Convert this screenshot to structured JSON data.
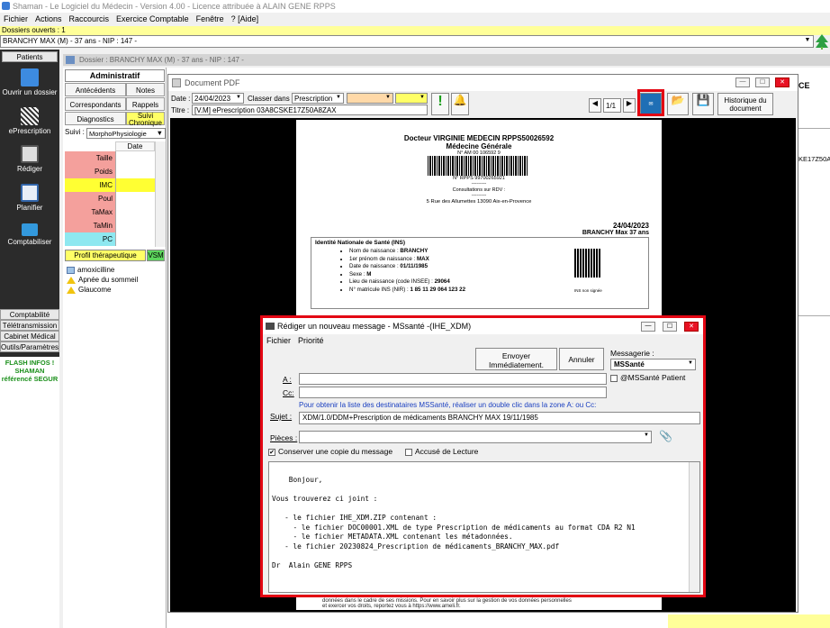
{
  "app": {
    "title": "Shaman - Le Logiciel du Médecin - Version 4.00 - Licence attribuée à ALAIN GENE RPPS",
    "menu": [
      "Fichier",
      "Actions",
      "Raccourcis",
      "Exercice Comptable",
      "Fenêtre",
      "? [Aide]"
    ],
    "dossiers_ouverts": "Dossiers ouverts : 1",
    "patient_combo": "BRANCHY MAX (M) - 37 ans - NIP : 147 -"
  },
  "sidebar": {
    "patients_tab": "Patients",
    "items": [
      {
        "label": "Ouvrir un dossier",
        "icon": "open-file-icon"
      },
      {
        "label": "ePrescription",
        "icon": "qr-code-icon"
      },
      {
        "label": "Rédiger",
        "icon": "printer-icon"
      },
      {
        "label": "Planifier",
        "icon": "calendar-icon"
      },
      {
        "label": "Comptabiliser",
        "icon": "calculator-icon"
      }
    ],
    "bottom_buttons": [
      "Comptabilité",
      "Télétransmission",
      "Cabinet Médical",
      "Outils/Paramètres"
    ],
    "flash": [
      "FLASH INFOS !",
      "SHAMAN",
      "référencé SEGUR"
    ]
  },
  "dossier": {
    "header": "Dossier : BRANCHY MAX (M) - 37 ans - NIP : 147 -",
    "tabs": {
      "administratif": "Administratif",
      "antecedents": "Antécédents",
      "notes": "Notes",
      "correspondants": "Correspondants",
      "rappels": "Rappels",
      "diagnostics": "Diagnostics",
      "suivi_chronique": "Suivi Chronique"
    },
    "suivi_label": "Suivi :",
    "suivi_value": "MorphoPhysiologie",
    "date_header": "Date",
    "measures": [
      {
        "label": "Taille",
        "color": "#f4a09c"
      },
      {
        "label": "Poids",
        "color": "#f4a09c"
      },
      {
        "label": "IMC",
        "color": "#ffff33"
      },
      {
        "label": "Poul",
        "color": "#f4a09c"
      },
      {
        "label": "TaMax",
        "color": "#f4a09c"
      },
      {
        "label": "TaMin",
        "color": "#f4a09c"
      },
      {
        "label": "PC",
        "color": "#8ee8f0"
      }
    ],
    "profil": "Profil thérapeutique",
    "vsm": "VSM",
    "allergies": [
      {
        "label": "amoxicilline",
        "type": "drug"
      },
      {
        "label": "Apnée du sommeil",
        "type": "warn"
      },
      {
        "label": "Glaucome",
        "type": "warn"
      }
    ],
    "right_fragment_1": "CE",
    "right_fragment_2": "KE17Z50A"
  },
  "pdf_window": {
    "title": "Document PDF",
    "date_label": "Date :",
    "date_value": "24/04/2023",
    "classer_label": "Classer dans :",
    "classer_value": "Prescription",
    "titre_label": "Titre :",
    "titre_value": "[V.M] ePrescription 03A8CSKE17Z50A8ZAX",
    "page_value": "1/1",
    "historique": "Historique du document",
    "document": {
      "doctor": "Docteur VIRGINIE MEDECIN RPPS50026592",
      "specialty": "Médecine Générale",
      "am": "N° AM 00 106592 9",
      "rpps": "N° RPPS 99700265921",
      "sep": "---------",
      "consult": "Consultations sur RDV :",
      "address": "5 Rue des Allumettes 13090 Aix-en-Provence",
      "date": "24/04/2023",
      "patient": "BRANCHY Max  37 ans",
      "ins_title": "Identité Nationale de Santé (INS)",
      "ins_lines": [
        {
          "k": "Nom de naissance : ",
          "v": "BRANCHY"
        },
        {
          "k": "1er prénom de naissance : ",
          "v": "MAX"
        },
        {
          "k": "Date de naissance : ",
          "v": "01/11/1985"
        },
        {
          "k": "Sexe : ",
          "v": "M"
        },
        {
          "k": "Lieu de naissance (code INSEE) : ",
          "v": "29064"
        },
        {
          "k": "N° matricule INS (NIR) : ",
          "v": "1 85 11 29 064 123 22"
        }
      ],
      "ins_non_signee": "INS non signée",
      "footer_1": "données dans le cadre de ses missions. Pour en savoir plus sur la gestion de vos données personnelles",
      "footer_2": "et exercer vos droits, reportez vous à https://www.ameli.fr."
    }
  },
  "message": {
    "title": "Rédiger un nouveau message - MSsanté -(IHE_XDM)",
    "menu": [
      "Fichier",
      "Priorité"
    ],
    "send_button": "Envoyer Immédiatement.",
    "cancel_button": "Annuler",
    "messagerie_label": "Messagerie :",
    "messagerie_value": "MSSanté",
    "patient_check": "@MSSanté Patient",
    "a_label": "A :",
    "cc_label": "Cc:",
    "hint": "Pour obtenir la liste des destinataires MSSanté, réaliser un double clic dans la zone A: ou Cc:",
    "sujet_label": "Sujet :",
    "sujet_value": "XDM/1.0/DDM+Prescription de médicaments BRANCHY MAX 19/11/1985",
    "pieces_label": "Pièces :",
    "keep_copy": "Conserver une copie du message",
    "accuse": "Accusé de Lecture",
    "body": "Bonjour,\n\nVous trouverez ci joint :\n\n   - le fichier IHE_XDM.ZIP contenant :\n     - le fichier DOC00001.XML de type Prescription de médicaments au format CDA R2 N1\n     - le fichier METADATA.XML contenant les métadonnées.\n   - le fichier 20230824_Prescription de médicaments_BRANCHY_MAX.pdf\n\nDr  Alain GENE RPPS"
  }
}
